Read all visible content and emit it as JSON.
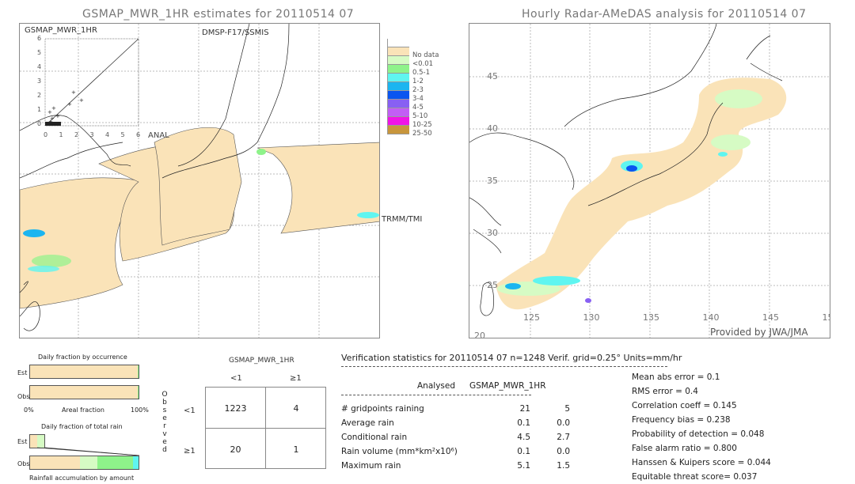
{
  "left_panel": {
    "title": "GSMAP_MWR_1HR estimates for 20110514 07",
    "scatter_label": "GSMAP_MWR_1HR",
    "scatter_x_label": "ANAL",
    "scatter_y_ticks": [
      "6",
      "5",
      "4",
      "3",
      "2",
      "1",
      "0"
    ],
    "scatter_x_ticks": [
      "0",
      "1",
      "2",
      "3",
      "4",
      "5",
      "6"
    ],
    "sensor_labels": [
      "DMSP-F17/SSMIS",
      "TRMM/TMI"
    ]
  },
  "legend": {
    "items": [
      {
        "label": "",
        "color": "#ffffff"
      },
      {
        "label": "No data",
        "color": "#fae3b8"
      },
      {
        "label": "<0.01",
        "color": "#d6fbc4"
      },
      {
        "label": "0.5-1",
        "color": "#8ef38a"
      },
      {
        "label": "1-2",
        "color": "#5ff5f0"
      },
      {
        "label": "2-3",
        "color": "#1bb5f0"
      },
      {
        "label": "3-4",
        "color": "#0a55f0"
      },
      {
        "label": "4-5",
        "color": "#8860f3"
      },
      {
        "label": "5-10",
        "color": "#c25ef5"
      },
      {
        "label": "10-25",
        "color": "#f014e6"
      },
      {
        "label": "25-50",
        "color": "#c8963c"
      }
    ]
  },
  "right_panel": {
    "title": "Hourly Radar-AMeDAS analysis for 20110514 07",
    "lat_ticks": [
      "45",
      "40",
      "35",
      "30",
      "25",
      "20"
    ],
    "lon_ticks": [
      "125",
      "130",
      "135",
      "140",
      "145",
      "15"
    ],
    "credit": "Provided by JWA/JMA"
  },
  "occurrence": {
    "title": "Daily fraction by occurrence",
    "est_label": "Est",
    "obs_label": "Obs",
    "axis_left": "0%",
    "axis_mid": "Areal fraction",
    "axis_right": "100%",
    "est_fractions": [
      {
        "color": "#fae3b8",
        "value": 0.995
      },
      {
        "color": "#8ef38a",
        "value": 0.005
      }
    ],
    "obs_fractions": [
      {
        "color": "#fae3b8",
        "value": 0.99
      },
      {
        "color": "#8ef38a",
        "value": 0.01
      }
    ]
  },
  "total_rain": {
    "title": "Daily fraction of total rain",
    "est_label": "Est",
    "obs_label": "Obs",
    "footer": "Rainfall accumulation by amount",
    "est_fractions": [
      {
        "color": "#fae3b8",
        "value": 0.5
      },
      {
        "color": "#d6fbc4",
        "value": 0.5
      }
    ],
    "obs_fractions": [
      {
        "color": "#fae3b8",
        "value": 0.46
      },
      {
        "color": "#d6fbc4",
        "value": 0.16
      },
      {
        "color": "#8ef38a",
        "value": 0.33
      },
      {
        "color": "#5ff5f0",
        "value": 0.05
      }
    ]
  },
  "contingency": {
    "model_label": "GSMAP_MWR_1HR",
    "col_headers": [
      "<1",
      "≥1"
    ],
    "row_headers": [
      "<1",
      "≥1"
    ],
    "observed_label": [
      "O",
      "b",
      "s",
      "e",
      "r",
      "v",
      "e",
      "d"
    ],
    "cells": [
      [
        "1223",
        "4"
      ],
      [
        "20",
        "1"
      ]
    ]
  },
  "verification": {
    "header": "Verification statistics for 20110514 07   n=1248   Verif. grid=0.25°   Units=mm/hr",
    "col_analysed": "Analysed",
    "col_model": "GSMAP_MWR_1HR",
    "rows": [
      {
        "label": "# gridpoints raining",
        "analysed": "21",
        "model": "5"
      },
      {
        "label": "Average rain",
        "analysed": "0.1",
        "model": "0.0"
      },
      {
        "label": "Conditional rain",
        "analysed": "4.5",
        "model": "2.7"
      },
      {
        "label": "Rain volume (mm*km²x10⁶)",
        "analysed": "0.1",
        "model": "0.0"
      },
      {
        "label": "Maximum rain",
        "analysed": "5.1",
        "model": "1.5"
      }
    ],
    "scores": [
      "Mean abs error = 0.1",
      "RMS error = 0.4",
      "Correlation coeff = 0.145",
      "Frequency bias = 0.238",
      "Probability of detection = 0.048",
      "False alarm ratio = 0.800",
      "Hanssen & Kuipers score = 0.044",
      "Equitable threat score= 0.037"
    ]
  }
}
